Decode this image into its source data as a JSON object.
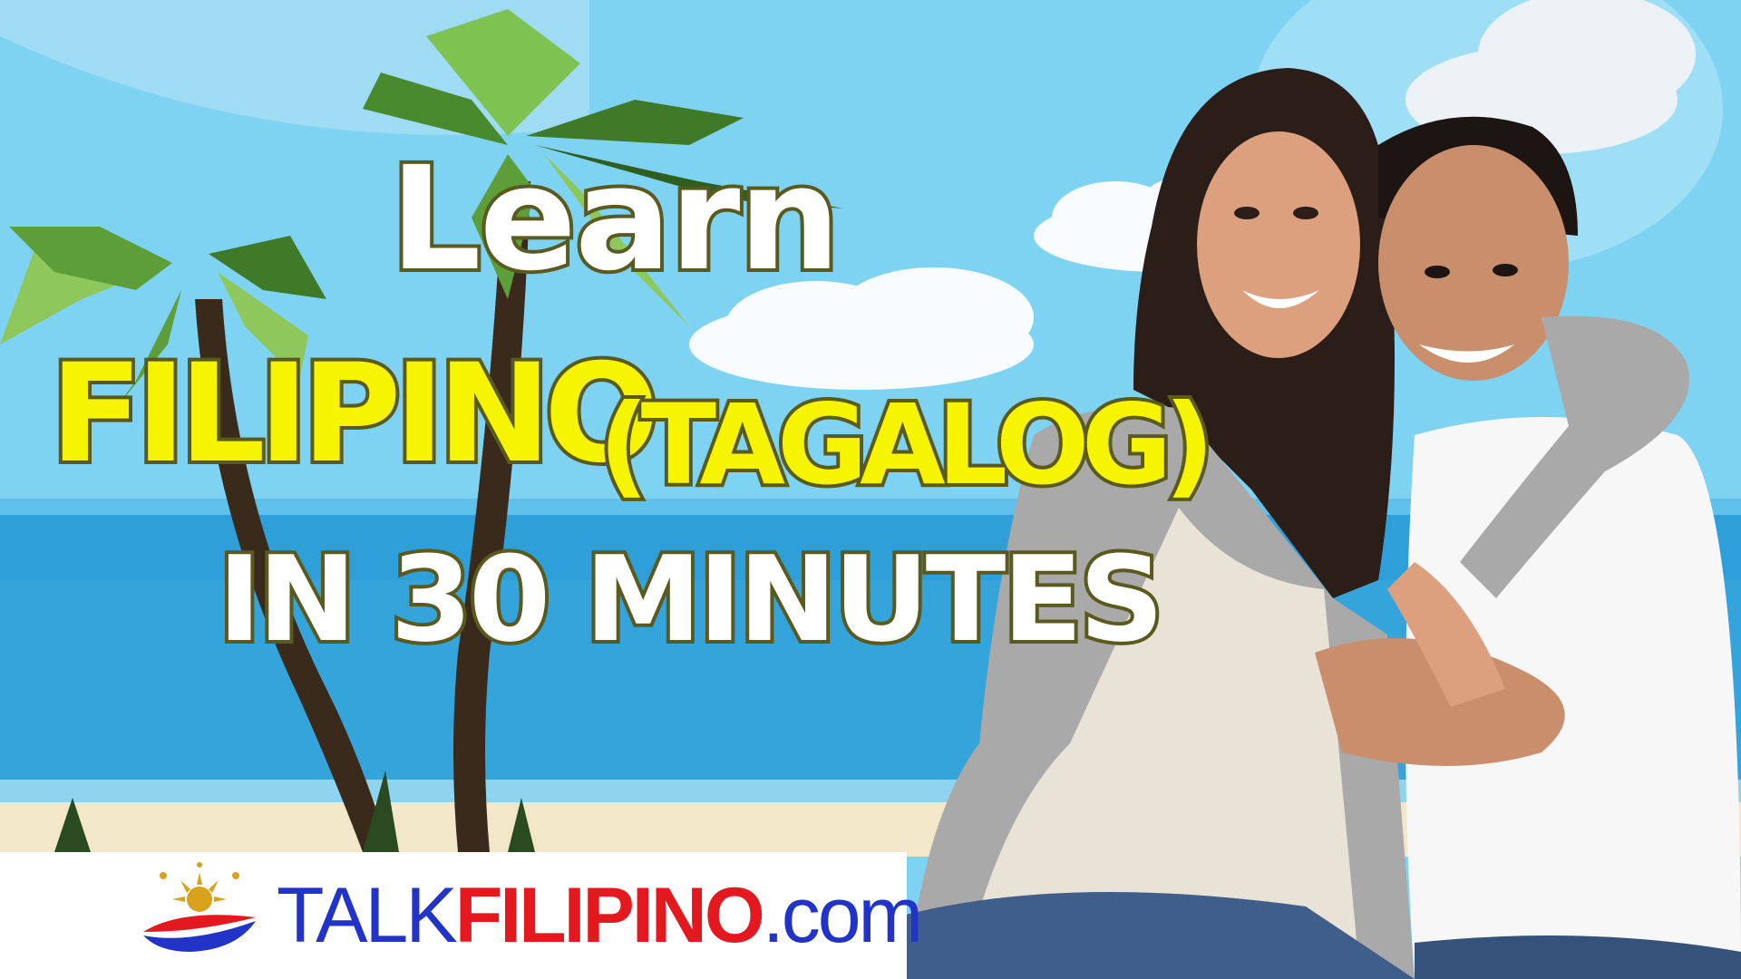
{
  "headline": {
    "line1": "Learn",
    "line2": "FILIPINO",
    "line2_paren": "(TAGALOG)",
    "line3": "IN 30 MINUTES"
  },
  "brand": {
    "part1": "TALK",
    "part2": "FILIPINO",
    "part3": ".com"
  },
  "colors": {
    "sky": "#7fd3f2",
    "sea": "#2e9fd8",
    "title_white": "#ffffff",
    "title_yellow": "#f7f400",
    "title_outline": "#5a5a1e",
    "brand_blue": "#2233c8",
    "brand_red": "#e3191f"
  },
  "illustration": {
    "background": "cartoon beach with palm trees",
    "people": "smiling couple embracing"
  }
}
